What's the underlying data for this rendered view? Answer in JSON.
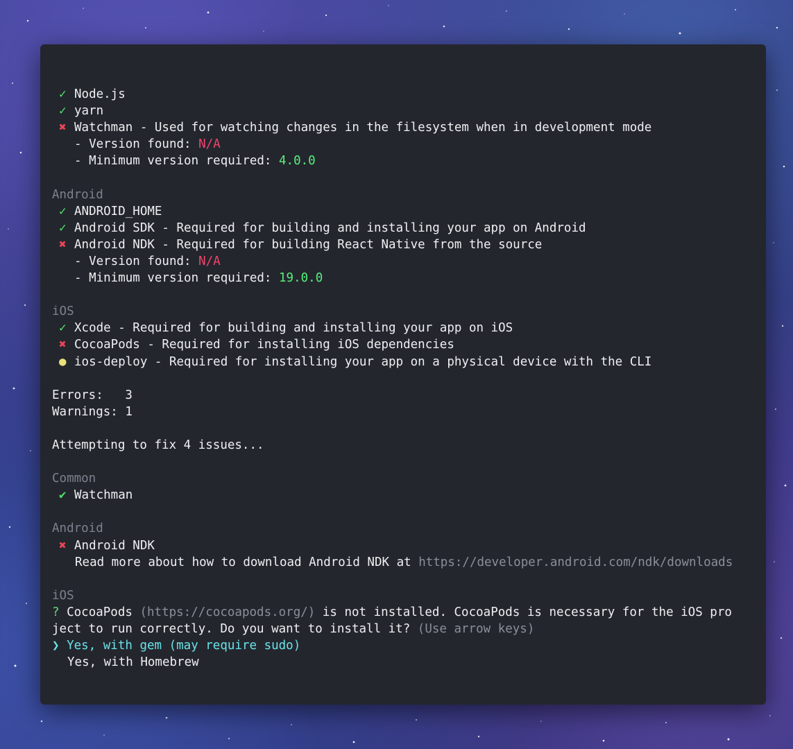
{
  "icons": {
    "ok": "✓",
    "ok_bold": "✔",
    "error": "✖",
    "warning": "●",
    "question": "?",
    "pointer": "❯"
  },
  "colors": {
    "terminal_bg": "#24262e",
    "text": "#eef0f2",
    "heading": "#7c828c",
    "ok": "#4ee06a",
    "error": "#ee4455",
    "warning": "#e8e07a",
    "value_ok": "#57f07a",
    "value_bad": "#f0456b",
    "selected": "#6ae3e8"
  },
  "common": {
    "nodejs": "Node.js",
    "yarn": "yarn",
    "watchman": "Watchman - Used for watching changes in the filesystem when in development mode",
    "version_found_label": "- Version found: ",
    "version_found_value": "N/A",
    "min_version_label": "- Minimum version required: ",
    "min_version_value": "4.0.0"
  },
  "android": {
    "heading": "Android",
    "android_home": "ANDROID_HOME",
    "android_sdk": "Android SDK - Required for building and installing your app on Android",
    "android_ndk": "Android NDK - Required for building React Native from the source",
    "version_found_label": "- Version found: ",
    "version_found_value": "N/A",
    "min_version_label": "- Minimum version required: ",
    "min_version_value": "19.0.0"
  },
  "ios": {
    "heading": "iOS",
    "xcode": "Xcode - Required for building and installing your app on iOS",
    "cocoapods": "CocoaPods - Required for installing iOS dependencies",
    "ios_deploy": "ios-deploy - Required for installing your app on a physical device with the CLI"
  },
  "summary": {
    "errors": "Errors:   3",
    "warnings": "Warnings: 1"
  },
  "fixing": "Attempting to fix 4 issues...",
  "fix_common": {
    "heading": "Common",
    "watchman": "Watchman"
  },
  "fix_android": {
    "heading": "Android",
    "ndk": "Android NDK",
    "read_more": "Read more about how to download Android NDK at ",
    "url": "https://developer.android.com/ndk/downloads"
  },
  "fix_ios": {
    "heading": "iOS",
    "prompt_name": "CocoaPods",
    "prompt_url": "(https://cocoapods.org/)",
    "prompt_text_1": " is not installed. CocoaPods is necessary for the iOS pro",
    "prompt_text_2": "ject to run correctly. Do you want to install it? ",
    "prompt_hint": "(Use arrow keys)",
    "option_gem": "Yes, with gem (may require sudo)",
    "option_homebrew": "Yes, with Homebrew"
  }
}
